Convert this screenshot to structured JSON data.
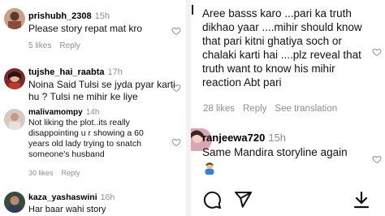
{
  "left_comments": [
    {
      "username": "prishubh_2308",
      "time": "15h",
      "text": "Please story repat mat kro",
      "likes": "5 likes",
      "reply": "Reply"
    },
    {
      "username": "tujshe_hai_raabta",
      "time": "17h",
      "text": "Noina Said Tulsi se jyda pyar karti hu ? Tulsi ne mihir ke liye"
    },
    {
      "username": "malivamompy",
      "time": "14h",
      "text": "Not liking the plot..its really disappointing u r showing a 60 years old lady trying to snatch someone's husband",
      "likes": "30 likes",
      "reply": "Reply"
    },
    {
      "username": "kaza_yashaswini",
      "time": "16h",
      "text": "Har baar wahi story"
    }
  ],
  "right": {
    "comment_text": "Aree basss karo ...pari ka truth dikhao yaar ....mihir should know that pari kitni ghatiya soch or chalaki karti hai ....plz reveal that truth want to know his mihir reaction Abt pari",
    "likes": "28 likes",
    "reply": "Reply",
    "see_translation": "See translation",
    "reply_comment": {
      "username": "ranjeewa720",
      "time": "15h",
      "text": "Same Mandira storyline again"
    }
  },
  "icons": {
    "like": "heart-outline-icon",
    "comment": "comment-bubble-icon",
    "share": "paper-plane-icon",
    "download": "download-arrow-icon"
  }
}
